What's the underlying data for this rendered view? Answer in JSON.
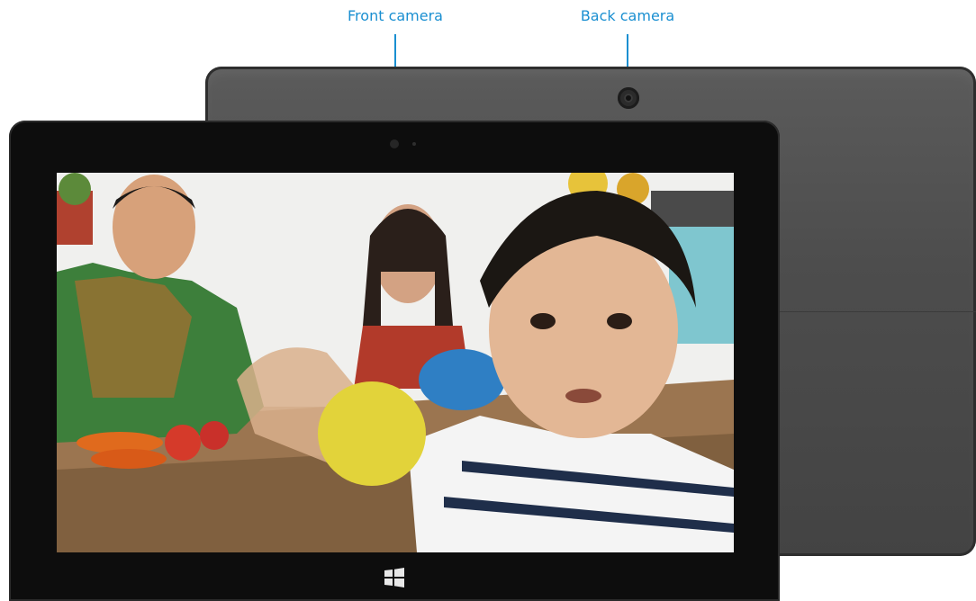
{
  "callouts": {
    "front_camera": "Front camera",
    "back_camera": "Back camera"
  },
  "colors": {
    "callout": "#1a8fd1",
    "bezel": "#0d0d0d",
    "back_shell": "#4d4d4d"
  },
  "icons": {
    "start": "windows-logo-icon"
  }
}
